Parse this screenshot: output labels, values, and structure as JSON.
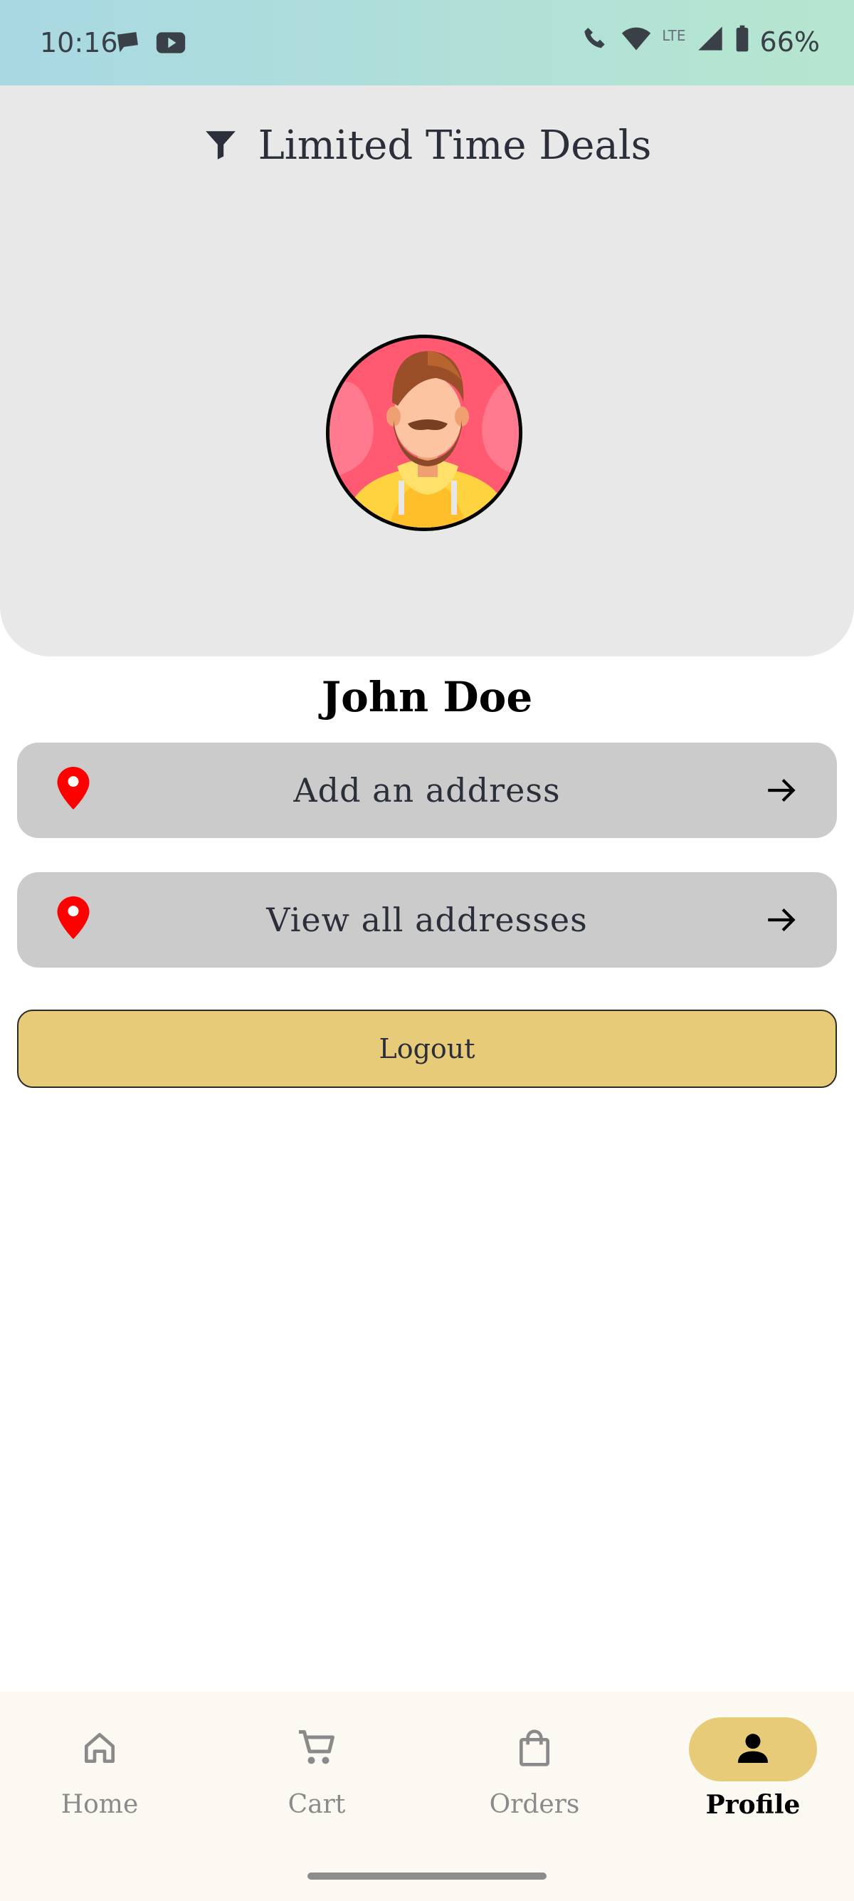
{
  "status_bar": {
    "time": "10:16",
    "battery": "66%",
    "network": "LTE"
  },
  "header": {
    "title": "Limited Time Deals",
    "filter_icon": "filter-icon"
  },
  "profile": {
    "name": "John Doe",
    "avatar_icon": "avatar-man-beard"
  },
  "actions": {
    "add_address": "Add an address",
    "view_addresses": "View all addresses",
    "logout": "Logout"
  },
  "colors": {
    "accent": "#e8cb79",
    "pin": "#ff0000",
    "row_bg": "#cbcbcb",
    "header_bg": "#e8e8e8"
  },
  "nav": {
    "items": [
      {
        "label": "Home",
        "icon": "home-icon"
      },
      {
        "label": "Cart",
        "icon": "cart-icon"
      },
      {
        "label": "Orders",
        "icon": "bag-icon"
      },
      {
        "label": "Profile",
        "icon": "person-icon",
        "active": true
      }
    ]
  }
}
